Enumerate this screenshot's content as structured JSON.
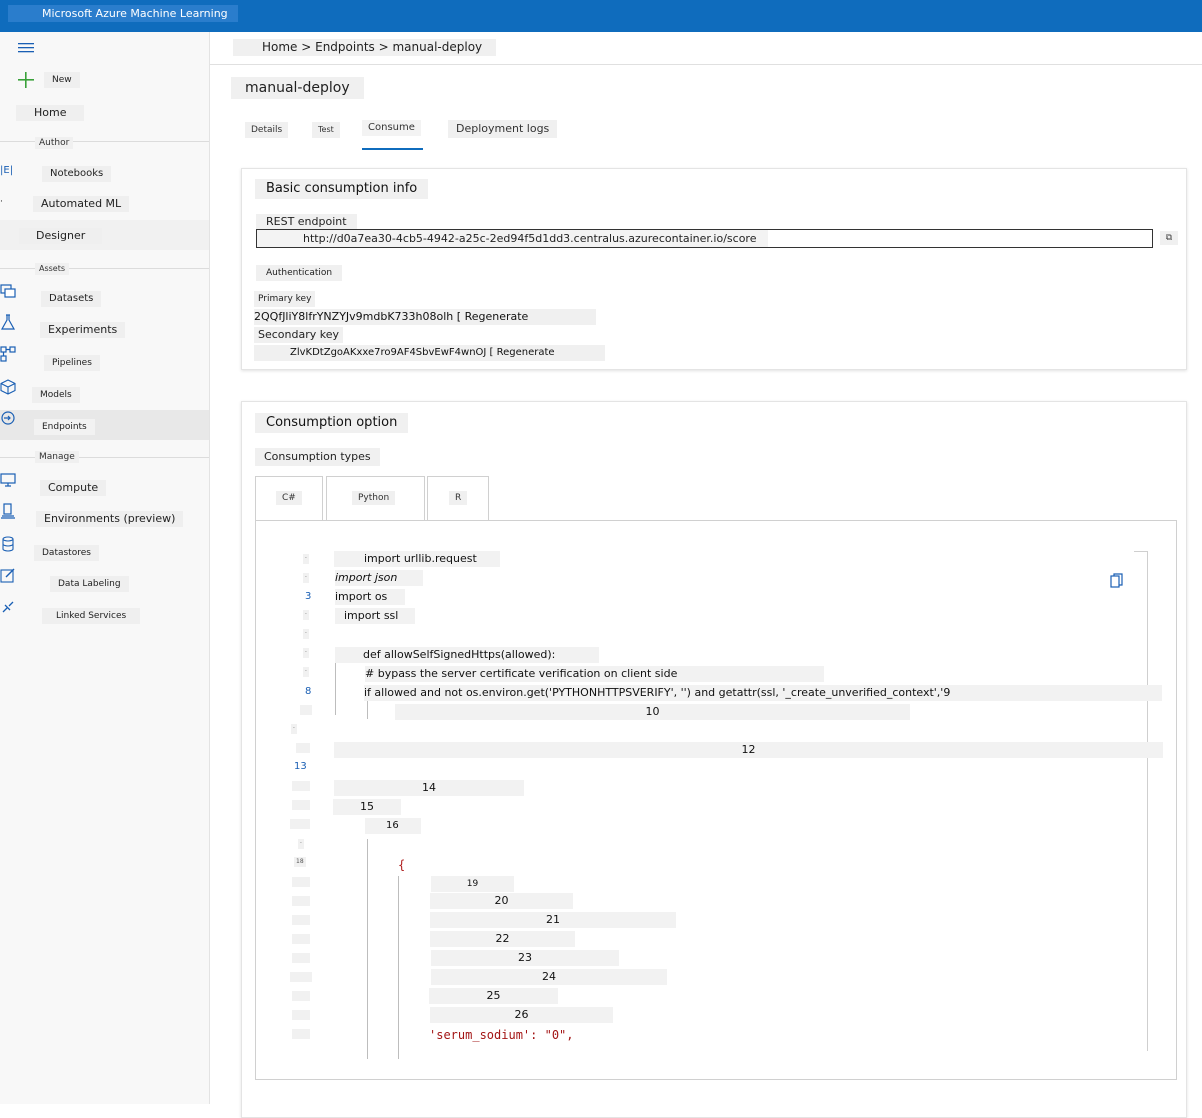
{
  "app": {
    "title": "Microsoft Azure Machine Learning"
  },
  "sidebar": {
    "menu_icon": "hamburger-icon",
    "new_label": "New",
    "home_label": "Home",
    "section_author": "Author",
    "section_assets": "Assets",
    "section_manage": "Manage",
    "items": {
      "notebooks": "Notebooks",
      "automated_ml": "Automated ML",
      "designer": "Designer",
      "datasets": "Datasets",
      "experiments": "Experiments",
      "pipelines": "Pipelines",
      "models": "Models",
      "endpoints": "Endpoints",
      "compute": "Compute",
      "environments": "Environments (preview)",
      "datastores": "Datastores",
      "data_labeling": "Data Labeling",
      "linked_services": "Linked Services"
    },
    "active_item": "Endpoints"
  },
  "breadcrumb": {
    "text": "Home > Endpoints > manual-deploy"
  },
  "page": {
    "title": "manual-deploy"
  },
  "tabs": {
    "details": "Details",
    "test": "Test",
    "consume": "Consume",
    "logs": "Deployment logs",
    "active": "Consume"
  },
  "basic": {
    "heading": "Basic consumption info",
    "rest_label": "REST endpoint",
    "rest_url": "http://d0a7ea30-4cb5-4942-a25c-2ed94f5d1dd3.centralus.azurecontainer.io/score",
    "auth_label": "Authentication",
    "primary_label": "Primary key",
    "primary_key": "2QQfJliY8lfrYNZYJv9mdbK733h08olh [ Regenerate",
    "secondary_label": "Secondary key",
    "secondary_key": "ZlvKDtZgoAKxxe7ro9AF4SbvEwF4wnOJ [ Regenerate"
  },
  "consumption": {
    "heading": "Consumption option",
    "types_label": "Consumption types",
    "lang_tabs": {
      "csharp": "C#",
      "python": "Python",
      "r": "R"
    },
    "line_numbers": {
      "l3": "3",
      "l8": "8",
      "l13": "13",
      "l18": "18"
    },
    "code": {
      "line1": "import urllib.request",
      "line2": "import json",
      "line3": "import os",
      "line4": "import ssl",
      "line6": "def allowSelfSignedHttps(allowed):",
      "line7": "# bypass the server certificate verification on client side",
      "line8": "if allowed and not os.environ.get('PYTHONHTTPSVERIFY', '') and getattr(ssl, '_create_unverified_context','9",
      "line10": "10",
      "line12": "12",
      "line14": "14",
      "line15": "15",
      "line16": "16",
      "brace": "{",
      "line19": "19",
      "line20": "20",
      "line21": "21",
      "line22": "22",
      "line23": "23",
      "line24": "24",
      "line25": "25",
      "line26": "26",
      "serum": "'serum_sodium': \"0\","
    }
  }
}
